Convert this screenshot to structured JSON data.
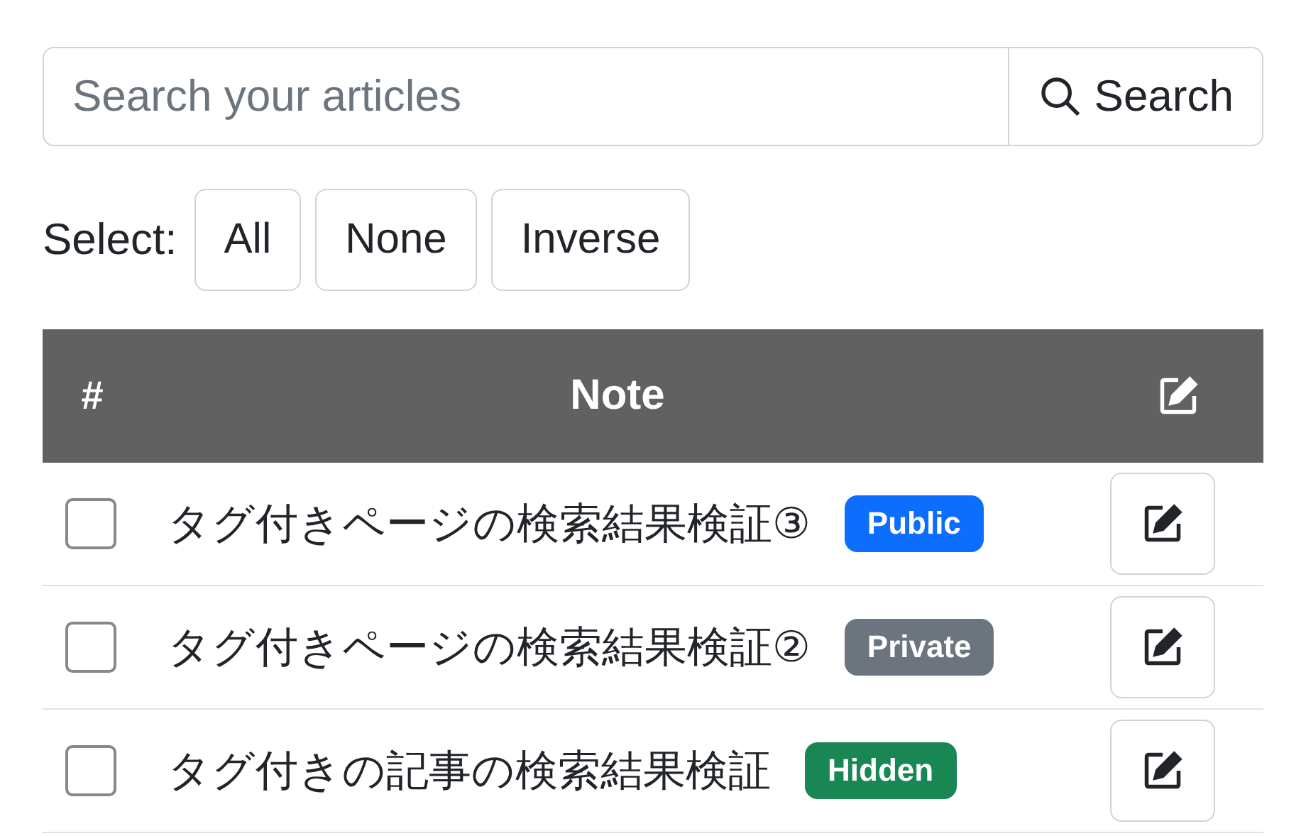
{
  "search": {
    "placeholder": "Search your articles",
    "button": "Search"
  },
  "select": {
    "label": "Select:",
    "buttons": [
      "All",
      "None",
      "Inverse"
    ]
  },
  "table": {
    "columns": [
      "#",
      "Note"
    ],
    "rows": [
      {
        "checked": false,
        "title": "タグ付きページの検索結果検証③",
        "badge": "Public",
        "color": "#0d6efd"
      },
      {
        "checked": false,
        "title": "タグ付きページの検索結果検証②",
        "badge": "Private",
        "color": "#6c757d"
      },
      {
        "checked": false,
        "title": "タグ付きの記事の検索結果検証",
        "badge": "Hidden",
        "color": "#198754"
      }
    ]
  }
}
